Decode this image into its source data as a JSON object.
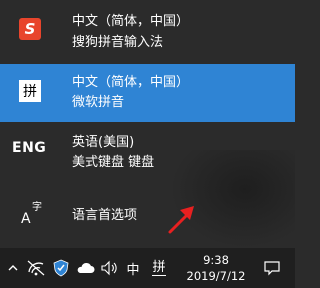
{
  "menu": {
    "items": [
      {
        "line1": "中文（简体，中国）",
        "line2": "搜狗拼音输入法",
        "icon": "sogou-icon",
        "icon_text": "S"
      },
      {
        "line1": "中文（简体，中国）",
        "line2": "微软拼音",
        "icon": "pinyin-icon",
        "icon_text": "拼",
        "selected": true
      },
      {
        "line1": "英语(美国)",
        "line2": "美式键盘 键盘",
        "icon": "eng-icon",
        "icon_text": "ENG"
      },
      {
        "line1": "语言首选项",
        "icon": "language-settings-icon",
        "icon_text": "字"
      }
    ]
  },
  "taskbar": {
    "ime_mode": "中",
    "ime_indicator": "拼",
    "time": "9:38",
    "date": "2019/7/12"
  },
  "colors": {
    "flyout_bg": "#2b2b2b",
    "selected_bg": "#2f84d4",
    "taskbar_bg": "#1f1f1f",
    "sogou_red": "#e8452c",
    "arrow_red": "#e82020"
  }
}
